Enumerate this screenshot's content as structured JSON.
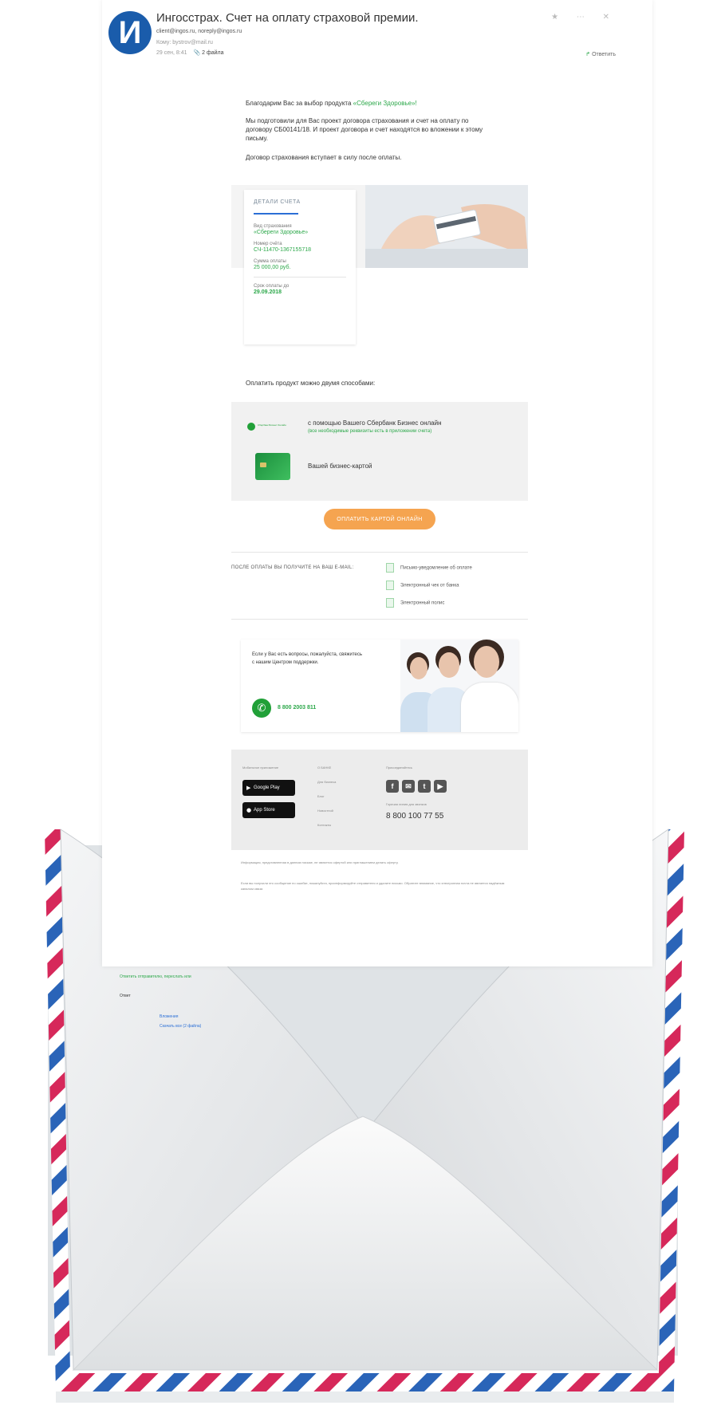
{
  "email": {
    "avatar_letter": "И",
    "subject": "Ингосстрах. Счет на оплату страховой премии.",
    "from": "client@ingos.ru, noreply@ingos.ru",
    "to": "Кому: bystrov@mail.ru",
    "date": "29 сен, 8:41",
    "attachments": "2 файла",
    "header_actions": "★ ⋯ ✕",
    "forward": "Ответить"
  },
  "body": {
    "thanks_prefix": "Благодарим Вас за выбор продукта",
    "product": "«Сбереги Здоровье»!",
    "prepared": "Мы подготовили для Вас проект договора страхования и счет на оплату по договору СБ00141/18. И проект договора и счет находятся во вложении к этому письму.",
    "effective": "Договор страхования вступает в силу после оплаты."
  },
  "invoice": {
    "title": "ДЕТАЛИ СЧЕТА",
    "type_label": "Вид страхования",
    "type_value": "«Сбереги Здоровье»",
    "number_label": "Номер счёта",
    "number_value": "СЧ-11470-1367155718",
    "amount_label": "Сумма оплаты",
    "amount_value": "25 000,00 руб.",
    "due_label": "Срок оплаты до",
    "due_value": "29.09.2018"
  },
  "payment": {
    "ways": "Оплатить продукт можно двумя способами:",
    "sbol_logo": "Сбербанк Бизнес Онлайн",
    "sbol": "с помощью Вашего Сбербанк Бизнес онлайн",
    "sbol_hint": "(все необходимые реквизиты есть в приложении счета)",
    "card": "Вашей бизнес-картой",
    "pay_button": "ОПЛАТИТЬ КАРТОЙ ОНЛАЙН"
  },
  "after": {
    "title": "ПОСЛЕ ОПЛАТЫ ВЫ ПОЛУЧИТЕ НА ВАШ E-MAIL:",
    "items": [
      "Письмо-уведомление об оплате",
      "Электронный чек от банка",
      "Электронный полис"
    ]
  },
  "support": {
    "text": "Если у Вас есть вопросы, пожалуйста, свяжитесь с нашим Центром поддержки.",
    "phone": "8 800 2003 811"
  },
  "footer": {
    "apps_label": "Мобильное приложение",
    "google_play": "Google Play",
    "app_store": "App Store",
    "links": [
      "О БАНКЕ",
      "Для бизнеса",
      "Блог",
      "Новостной",
      "Контакты"
    ],
    "social_label": "Присоединяйтесь",
    "social": [
      "f",
      "✉",
      "t",
      "▶"
    ],
    "phone_label": "Горячая линия для звонков",
    "phone": "8 800 100 77 55"
  },
  "disclaimer": {
    "p1": "Информация, представленная в данном письме, не является офертой или приглашением делать оферту.",
    "p2": "Если вы получили это сообщение по ошибке, пожалуйста, проинформируйте отправителя и удалите письмо. Обратите внимание, что электронная почта не является надёжным каналом связи."
  },
  "below_letter": {
    "line1": "Ответить отправителю, переслать или",
    "line2": "Ответ",
    "line3": "Вложения",
    "line4": "Скачать все  (2 файла)"
  },
  "colors": {
    "accent_green": "#2ca84a",
    "brand_blue": "#1a5cab",
    "button_orange": "#f5a450"
  }
}
